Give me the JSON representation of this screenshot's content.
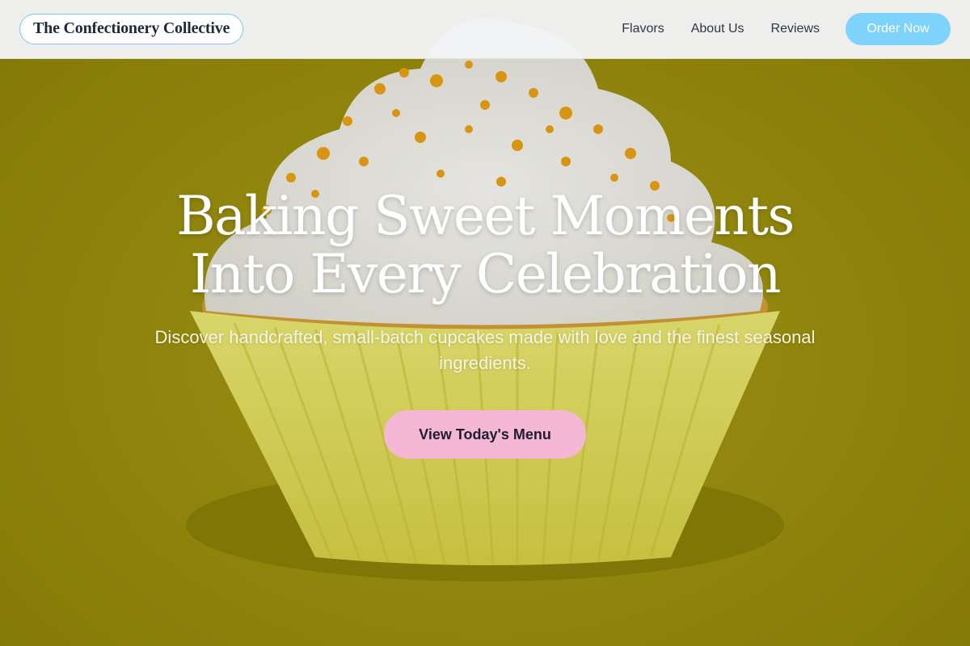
{
  "header": {
    "brand": "The Confectionery Collective",
    "nav": [
      "Flavors",
      "About Us",
      "Reviews"
    ],
    "order_button": "Order Now"
  },
  "hero": {
    "headline_line1": "Baking Sweet Moments",
    "headline_line2": "Into Every Celebration",
    "subheadline": "Discover handcrafted, small-batch cupcakes made with love and the finest seasonal ingredients.",
    "cta": "View Today's Menu"
  },
  "colors": {
    "background": "#a19510",
    "order_button": "#7dd3fc",
    "cta_button": "#f4b8d4",
    "brand_border": "#7cc8ef"
  }
}
